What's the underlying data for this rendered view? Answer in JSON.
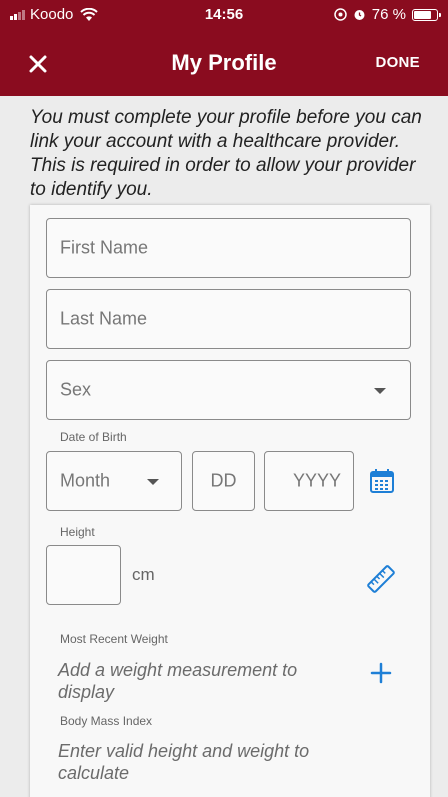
{
  "status_bar": {
    "carrier": "Koodo",
    "time": "14:56",
    "battery_percent": "76 %",
    "battery_level": 0.76
  },
  "nav": {
    "title": "My Profile",
    "done_label": "DONE",
    "close_icon": "close-icon"
  },
  "notice": "You must complete your profile before you can link your account with a healthcare provider. This is required in order to allow your provider to identify you.",
  "form": {
    "first_name_placeholder": "First Name",
    "last_name_placeholder": "Last Name",
    "sex_placeholder": "Sex",
    "dob_label": "Date of Birth",
    "month_placeholder": "Month",
    "day_placeholder": "DD",
    "year_placeholder": "YYYY",
    "height_label": "Height",
    "height_unit": "cm",
    "weight_label": "Most Recent Weight",
    "weight_prompt": "Add a weight measurement to display",
    "bmi_label": "Body Mass Index",
    "bmi_prompt": "Enter valid height and weight to calculate"
  },
  "colors": {
    "header": "#8a0c1f",
    "accent": "#1e7fd6"
  }
}
